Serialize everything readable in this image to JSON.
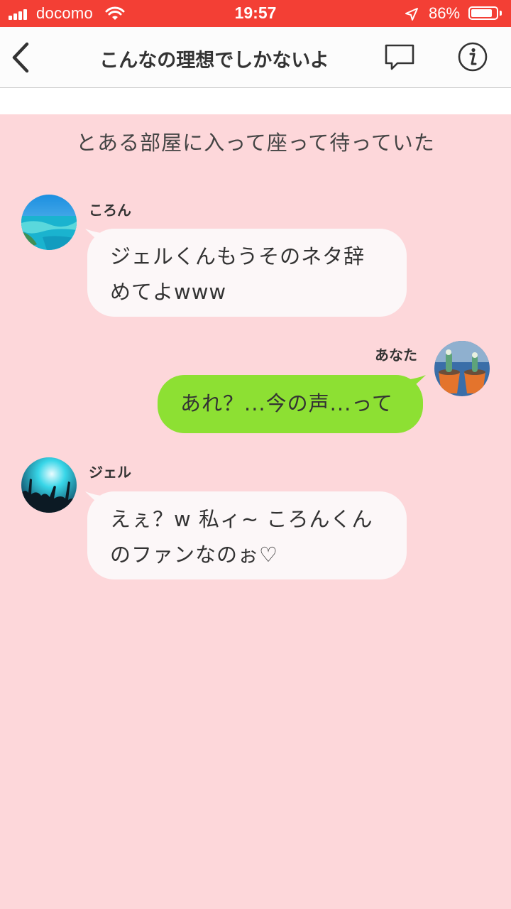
{
  "status": {
    "carrier": "docomo",
    "time": "19:57",
    "battery_percent": "86%",
    "battery_level": 0.86
  },
  "nav": {
    "title": "こんなの理想でしかないよ"
  },
  "chat": {
    "narration": "とある部屋に入って座って待っていた",
    "messages": [
      {
        "sender": "ころん",
        "side": "left",
        "lines": [
          "ジェルくんもうそのネタ辞",
          "めてよwww"
        ],
        "avatar": "ocean-photo"
      },
      {
        "sender": "あなた",
        "side": "right",
        "lines": [
          "あれ？...今の声...って"
        ],
        "avatar": "cactus-photo"
      },
      {
        "sender": "ジェル",
        "side": "left",
        "lines": [
          "えぇ？w 私ィ~ ころんくん",
          "のファンなのぉ♡"
        ],
        "avatar": "concert-photo"
      }
    ]
  },
  "colors": {
    "status_bar": "#f33f35",
    "background": "#fdd7da",
    "bubble_left": "#fcf7f8",
    "bubble_right": "#8de033"
  }
}
